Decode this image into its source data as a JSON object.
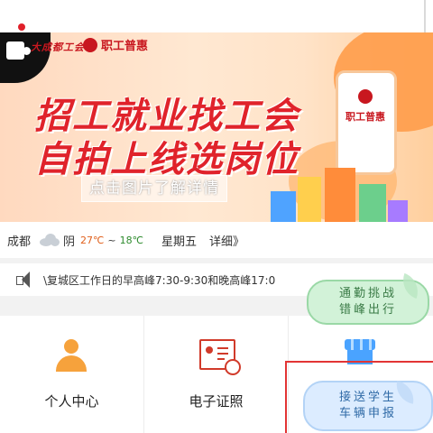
{
  "banner": {
    "logo_left": "大成都工会",
    "logo_right": "职工普惠",
    "headline_line1": "招工就业找工会",
    "headline_line2": "自拍上线选岗位",
    "cta_text": "点击图片了解详情",
    "phone_text": "职工普惠",
    "pager_count": 3,
    "pager_active_index": 1
  },
  "weather": {
    "city": "成都",
    "icon": "cloud-icon",
    "condition": "阴",
    "high": "27℃",
    "separator": "~",
    "low": "18℃",
    "day": "星期五",
    "detail_link": "详细》",
    "high_color": "#e0601c",
    "low_color": "#2e8b2e"
  },
  "notice": {
    "icon": "speaker-icon",
    "text": "\\复城区工作日的早高峰7:30-9:30和晚高峰17:0"
  },
  "grid": {
    "items": [
      {
        "label": "个人中心",
        "icon": "person-icon"
      },
      {
        "label": "电子证照",
        "icon": "certificate-icon"
      },
      {
        "label": "",
        "icon": "store-icon"
      }
    ]
  },
  "floating": {
    "commute_button": "通勤挑战错峰出行",
    "commute_line1": "通勤挑战",
    "commute_line2": "错峰出行",
    "school_button": "接送学生车辆申报",
    "school_line1": "接送学生",
    "school_line2": "车辆申报"
  },
  "colors": {
    "brand_red": "#e0232b",
    "accent_orange": "#f6a23c",
    "cert_red": "#d13a2a",
    "store_blue": "#4aa3ff",
    "highlight_frame": "#e23434"
  }
}
